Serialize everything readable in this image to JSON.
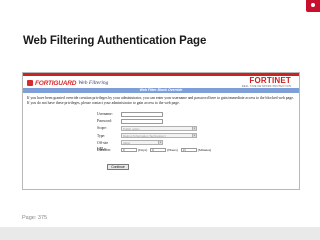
{
  "slide": {
    "title": "Web Filtering Authentication Page",
    "page_label": "Page: 375",
    "accent_color": "#c8102e"
  },
  "screen": {
    "fortiguard_logo": "FORTIGUARD",
    "fortiguard_subtitle": "Web Filtering",
    "fortinet_logo": "FORTINET",
    "fortinet_tagline": "REAL TIME NETWORK PROTECTION",
    "band_title": "Web Filter Block Override",
    "message": "If you have been granted override creation privileges by your administrator, you can enter your username and password here to gain immediate access to the blocked web page. If you do not have these privileges, please contact your administrator to gain access to the web page.",
    "band_color": "#7f9fd8",
    "form": {
      "username_label": "Username:",
      "password_label": "Password:",
      "scope_label": "Scope:",
      "scope_value": "Public policy",
      "type_label": "Type:",
      "type_value": "Rating (Information Technology)",
      "offsite_label": "Off-site URLs:",
      "offsite_value": "Allow",
      "duration_label": "Duration:",
      "duration_days_unit": "(Days)",
      "duration_hours_unit": "(Hours)",
      "duration_minutes_unit": "(Minutes)",
      "days_value": "0",
      "hours_value": "0",
      "minutes_value": "15",
      "continue_label": "Continue"
    }
  }
}
